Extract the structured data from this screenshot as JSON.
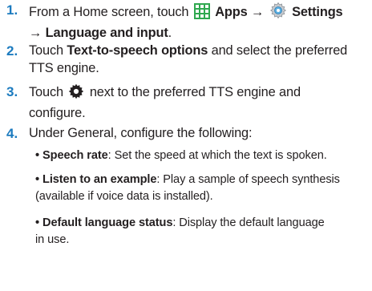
{
  "steps": [
    {
      "number": "1.",
      "prefix": "From a Home screen, touch",
      "apps_label": "Apps",
      "arrow": "→",
      "settings_label": "Settings",
      "arrow2": "→",
      "language_label": "Language and input",
      "end": ".",
      "icons": [
        "apps-grid-icon",
        "settings-gear-icon"
      ]
    },
    {
      "number": "2.",
      "prefix": "Touch",
      "bold": "Text-to-speech options",
      "rest": "and select the preferred",
      "line2": "TTS engine."
    },
    {
      "number": "3.",
      "prefix": "Touch",
      "icon": "cog-icon",
      "rest": "next to the preferred TTS engine and",
      "line2": "configure."
    },
    {
      "number": "4.",
      "text": "Under General, configure the following:"
    }
  ],
  "sub_items": [
    {
      "bullet": "•",
      "term": "Speech rate",
      "desc": ": Set the speed at which the text is spoken."
    },
    {
      "bullet": "•",
      "term": "Listen to an example",
      "desc": ": Play a sample of speech synthesis",
      "line2": "(available if voice data is installed)."
    },
    {
      "bullet": "•",
      "term": "Default language status",
      "desc": ": Display the default language",
      "line2": "in use."
    }
  ],
  "colors": {
    "step_number": "#1c7bbf",
    "text": "#231f20",
    "apps_icon": "#2fa84f"
  }
}
